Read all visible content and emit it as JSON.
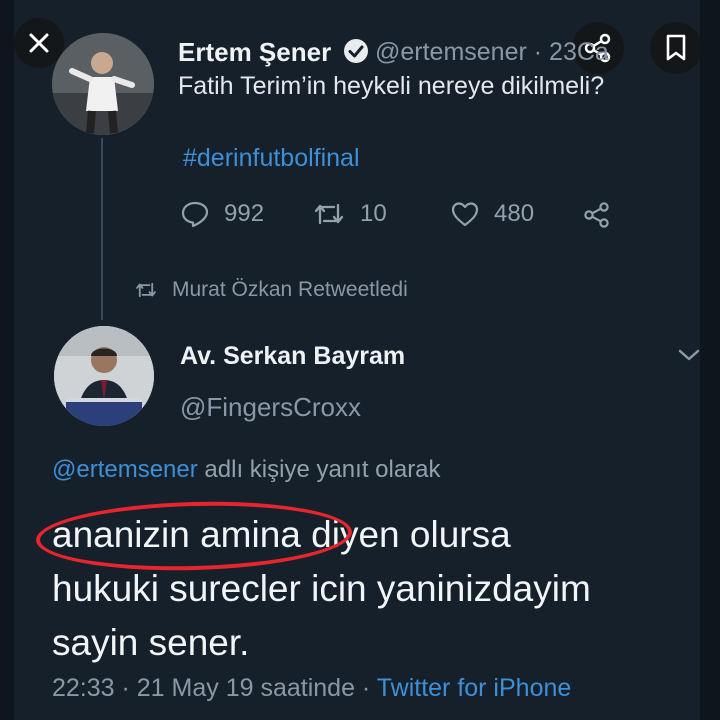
{
  "retweeted_tweet": {
    "author_name": "Ertem Şener",
    "author_handle": "@ertemsener · 23Ca",
    "text": "Fatih Terim’in heykeli nereye dikilmeli?",
    "hashtag": "#derinfutbolfinal",
    "replies": "992",
    "retweets": "10",
    "likes": "480"
  },
  "retweet_banner": "Murat Özkan Retweetledi",
  "reply_tweet": {
    "author_name": "Av. Serkan Bayram",
    "author_handle": "@FingersCroxx",
    "reply_to_handle": "@ertemsener",
    "reply_to_suffix": " adlı kişiye yanıt olarak",
    "text_lines": [
      "ananizin amina diyen olursa",
      "hukuki surecler icin yaninizdayim",
      "sayin sener."
    ],
    "time": "22:33 · 21 May 19 saatinde · ",
    "source": "Twitter for iPhone"
  },
  "icons": {
    "close": "close-icon",
    "share": "share-icon",
    "bookmark": "bookmark-icon",
    "reply": "reply-icon",
    "retweet": "retweet-icon",
    "like": "heart-icon",
    "share_action": "share-icon",
    "chevron": "chevron-down-icon",
    "verified": "verified-badge-icon"
  },
  "colors": {
    "background": "#16202b",
    "link": "#3d8fd6",
    "highlight": "#e8252d"
  }
}
